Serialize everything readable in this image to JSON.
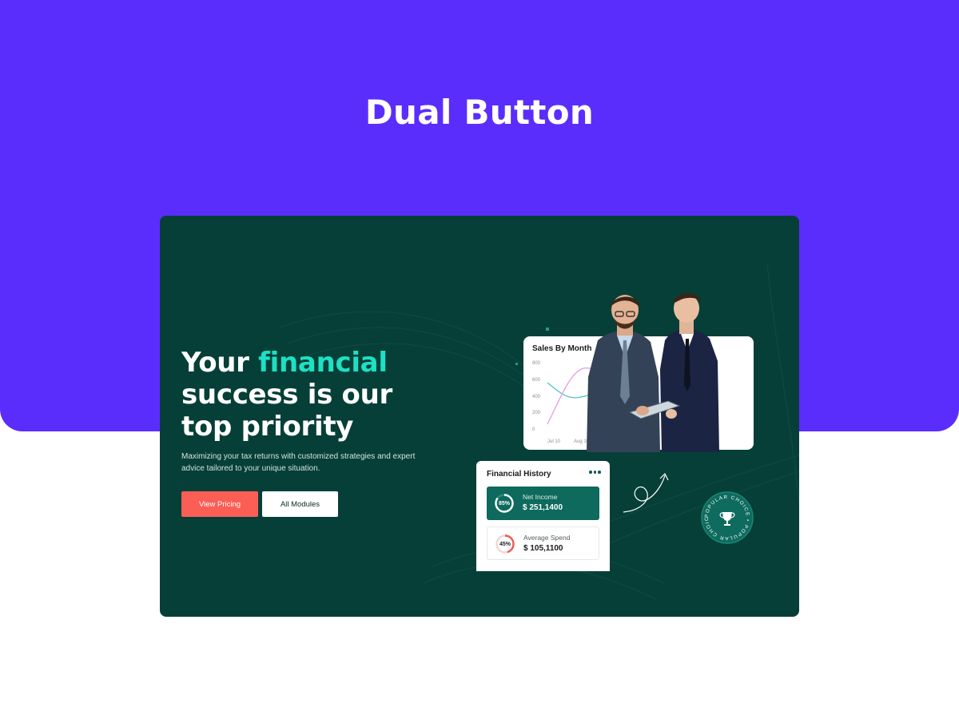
{
  "header": {
    "title": "Dual Button"
  },
  "hero": {
    "headline_part1": "Your ",
    "headline_accent": "financial",
    "headline_part2": " success is our top priority",
    "subtext": "Maximizing your tax returns with customized strategies and expert advice tailored to your unique situation.",
    "primary_button": "View Pricing",
    "secondary_button": "All Modules"
  },
  "sales_card": {
    "title": "Sales By Month",
    "y_ticks": [
      "800",
      "600",
      "400",
      "200",
      "0"
    ],
    "x_ticks": [
      "Jul 10",
      "Aug 10"
    ]
  },
  "financial_history": {
    "title": "Financial History",
    "items": [
      {
        "percent": "85%",
        "label": "Net Income",
        "value": "$ 251,1400",
        "progress": 0.85
      },
      {
        "percent": "45%",
        "label": "Average Spend",
        "value": "$ 105,1100",
        "progress": 0.45
      }
    ]
  },
  "badge": {
    "text": "POPULAR CHOICE • POPULAR CHOICE •"
  },
  "colors": {
    "band": "#5b2dfd",
    "hero_bg": "#063f37",
    "accent": "#1de0c4",
    "primary_button": "#fb5e55",
    "net_income_bg": "#0d6a5c"
  }
}
